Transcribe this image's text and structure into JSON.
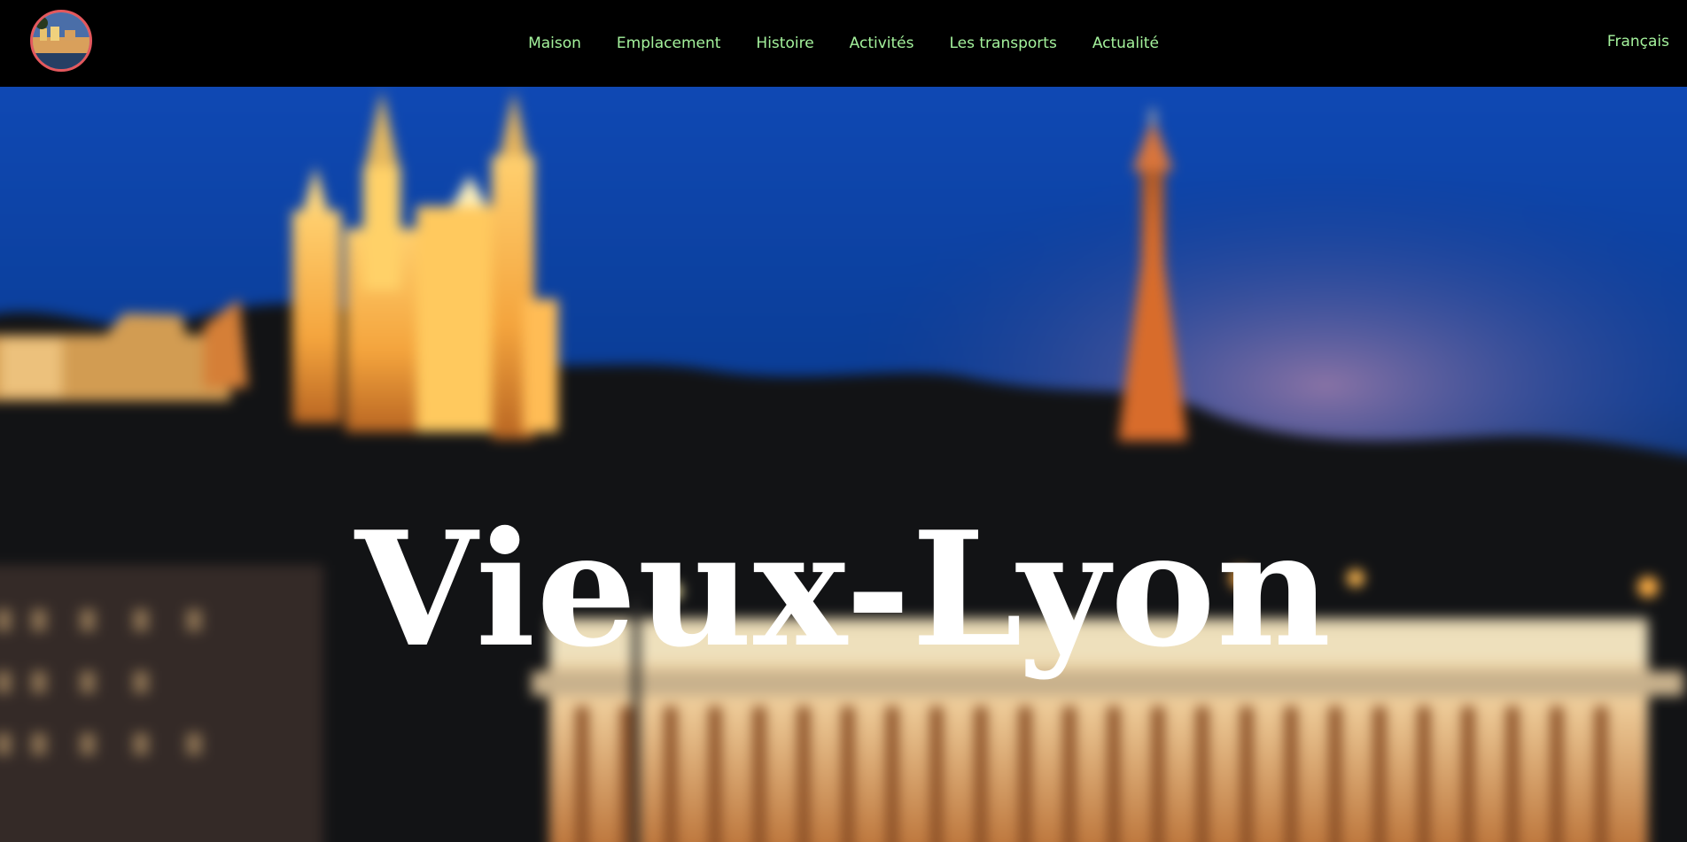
{
  "nav": {
    "items": [
      "Maison",
      "Emplacement",
      "Histoire",
      "Activités",
      "Les transports",
      "Actualité"
    ],
    "language": "Français"
  },
  "hero": {
    "title": "Vieux-Lyon"
  },
  "colors": {
    "nav_text": "#a4f29c",
    "logo_border": "#e4585d",
    "topbar_bg": "#000000",
    "title": "#ffffff"
  },
  "icons": {
    "logo": "vieux-lyon-logo-icon"
  }
}
